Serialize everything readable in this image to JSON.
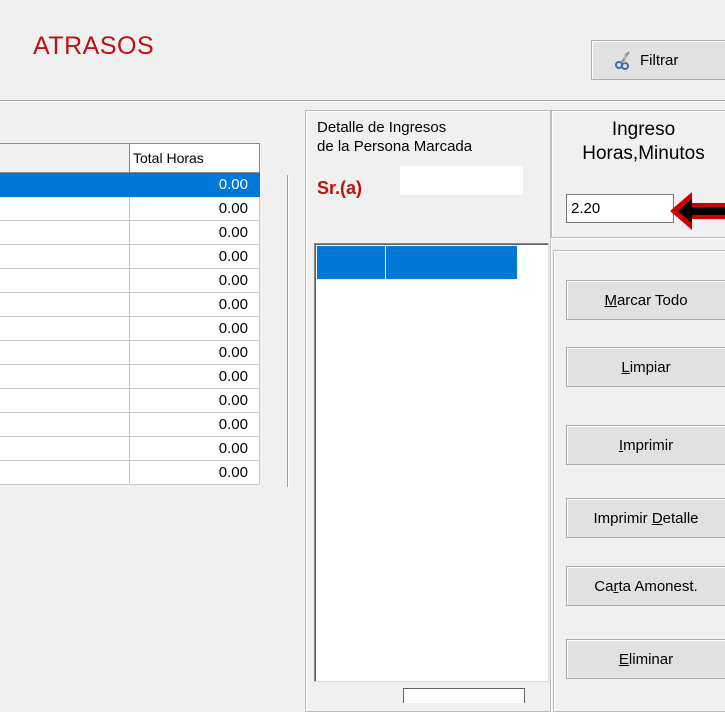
{
  "header": {
    "title": "ATRASOS",
    "filter_label": "Filtrar"
  },
  "grid": {
    "column_header": "Total Horas",
    "rows": [
      "0.00",
      "0.00",
      "0.00",
      "0.00",
      "0.00",
      "0.00",
      "0.00",
      "0.00",
      "0.00",
      "0.00",
      "0.00",
      "0.00",
      "0.00"
    ],
    "selected_row_index": 0
  },
  "detail": {
    "label_line1": "Detalle de Ingresos",
    "label_line2": "de la Persona Marcada",
    "sra_label": "Sr.(a)",
    "sra_value": ""
  },
  "ingreso": {
    "label_line1": "Ingreso",
    "label_line2": "Horas,Minutos",
    "value": "2.20"
  },
  "buttons": {
    "marcar_todo": {
      "mnemonic": "M",
      "rest": "arcar Todo"
    },
    "limpiar": {
      "mnemonic": "L",
      "rest": "impiar"
    },
    "imprimir": {
      "mnemonic": "I",
      "rest": "mprimir"
    },
    "imprimir_detalle": {
      "prefix": "Imprimir ",
      "mnemonic": "D",
      "rest": "etalle"
    },
    "carta_amonest": {
      "prefix": "Ca",
      "mnemonic": "r",
      "rest": "ta Amonest."
    },
    "eliminar": {
      "mnemonic": "E",
      "rest": "liminar"
    }
  },
  "colors": {
    "accent": "#0078d7",
    "title": "#c01010",
    "arrow": "#cc0000"
  }
}
